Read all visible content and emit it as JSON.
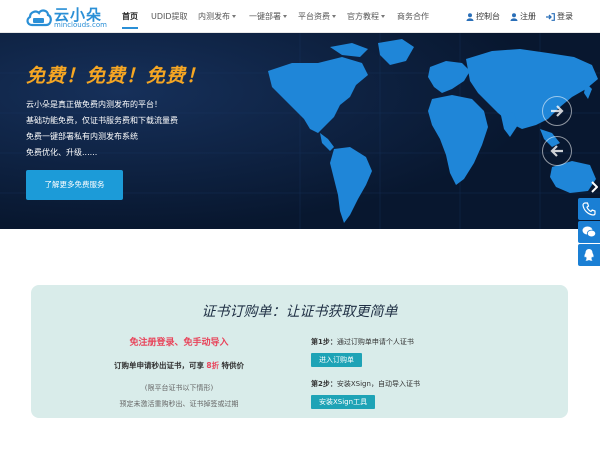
{
  "brand": {
    "name": "云小朵",
    "domain": "minclouds.com",
    "badge": "云小朵"
  },
  "nav": {
    "items": [
      {
        "label": "首页",
        "active": true,
        "dropdown": false
      },
      {
        "label": "UDID提取",
        "active": false,
        "dropdown": false
      },
      {
        "label": "内测发布",
        "active": false,
        "dropdown": true
      },
      {
        "label": "一键部署",
        "active": false,
        "dropdown": true
      },
      {
        "label": "平台资费",
        "active": false,
        "dropdown": true
      },
      {
        "label": "官方教程",
        "active": false,
        "dropdown": true
      },
      {
        "label": "商务合作",
        "active": false,
        "dropdown": false
      }
    ],
    "account": {
      "console": "控制台",
      "register": "注册",
      "login": "登录"
    }
  },
  "hero": {
    "headline": "免费！免费！免费！",
    "lines": [
      "云小朵是真正做免费内测发布的平台！",
      "基础功能免费，仅证书服务费和下载流量费",
      "免费一键部署私有内测发布系统",
      "免费优化、升级......"
    ],
    "button": "了解更多免费服务"
  },
  "card": {
    "title": "证书订购单：让证书获取更简单",
    "promo": "免注册登录、免手动导入",
    "offer_prefix": "订购单申请秒出证书，可享",
    "offer_highlight": "8折",
    "offer_suffix": "特供价",
    "note1": "(限平台证书以下情形)",
    "note2": "预定未激活重购秒出、证书掉签或过期",
    "step1_label": "第1步：",
    "step1_text": "通过订购单申请个人证书",
    "step1_button": "进入订购单",
    "step2_label": "第2步：",
    "step2_text": "安装XSign，自动导入证书",
    "step2_button": "安装XSign工具"
  },
  "colors": {
    "brand_blue": "#2a8fd6",
    "hero_bg": "#0b1d3a",
    "map_blue": "#1f86d8",
    "headline_orange": "#f5a623",
    "cta_blue": "#1c9bd8",
    "promo_red": "#e8435a",
    "card_bg": "#d9ecea",
    "step_button": "#1ea3b6"
  },
  "icons": {
    "logo": "cloud-logo-icon",
    "console": "user-shield-icon",
    "register": "user-icon",
    "login": "login-arrow-icon",
    "next": "arrow-right-icon",
    "prev": "arrow-left-icon",
    "slide_next": "chevron-right-icon",
    "phone": "phone-icon",
    "wechat": "wechat-icon",
    "qq": "qq-icon"
  }
}
